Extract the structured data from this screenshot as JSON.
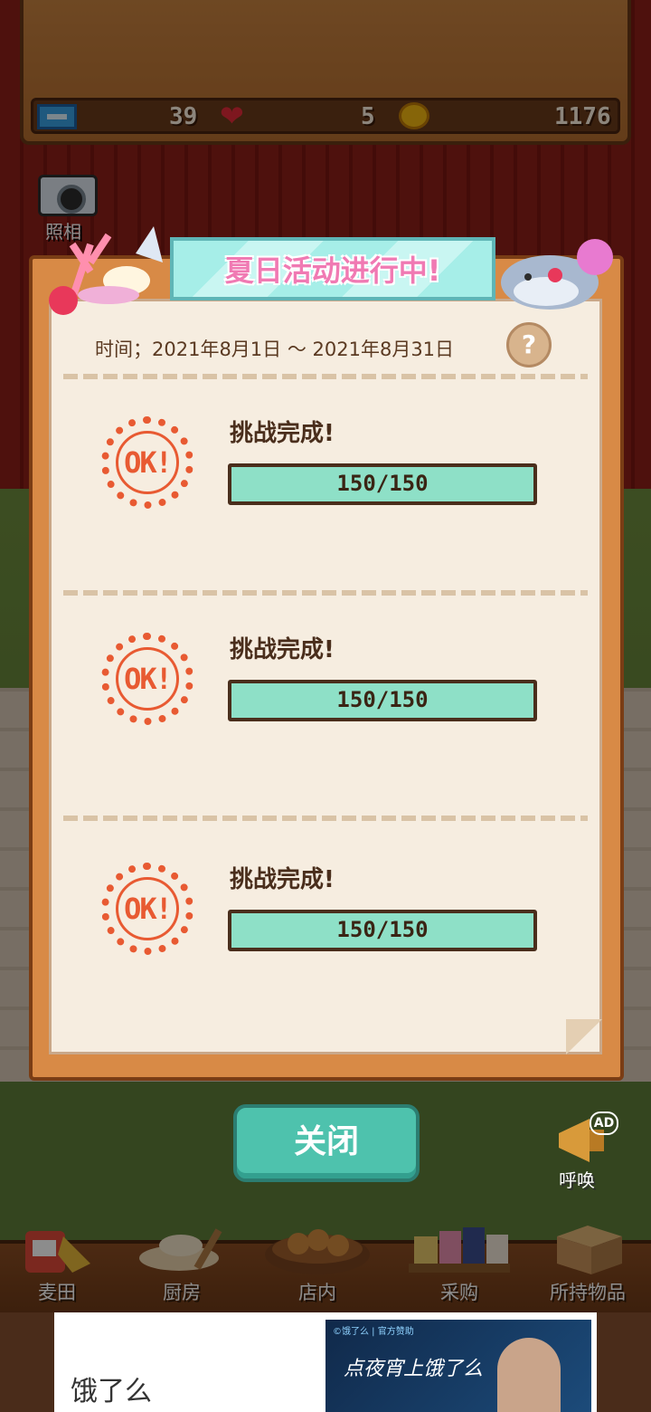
{
  "resources": {
    "tickets": "39",
    "hearts": "5",
    "coins": "1176"
  },
  "camera": {
    "label": "照相"
  },
  "event": {
    "title": "夏日活动进行中!",
    "date_range": "时间；2021年8月1日 ～ 2021年8月31日",
    "help_symbol": "?",
    "challenges": [
      {
        "status": "挑战完成!",
        "stamp": "OK!",
        "progress": "150/150",
        "fraction": 1.0
      },
      {
        "status": "挑战完成!",
        "stamp": "OK!",
        "progress": "150/150",
        "fraction": 1.0
      },
      {
        "status": "挑战完成!",
        "stamp": "OK!",
        "progress": "150/150",
        "fraction": 1.0
      }
    ]
  },
  "close_button": {
    "label": "关闭"
  },
  "call": {
    "label": "呼唤",
    "badge": "AD"
  },
  "nav": [
    {
      "label": "麦田",
      "icon": "wheat-field-icon"
    },
    {
      "label": "厨房",
      "icon": "kitchen-icon"
    },
    {
      "label": "店内",
      "icon": "bread-store-icon"
    },
    {
      "label": "采购",
      "icon": "shopping-icon"
    },
    {
      "label": "所持物品",
      "icon": "inventory-box-icon"
    }
  ],
  "ad": {
    "title": "饿了么",
    "small_text": "©饿了么 | 官方赞助",
    "slogan": "点夜宵上饿了么"
  },
  "colors": {
    "accent_teal": "#4ec2ad",
    "stamp_red": "#e85a32",
    "banner_pink": "#f07ab3",
    "paper": "#f6ede0",
    "frame": "#d88a46"
  }
}
